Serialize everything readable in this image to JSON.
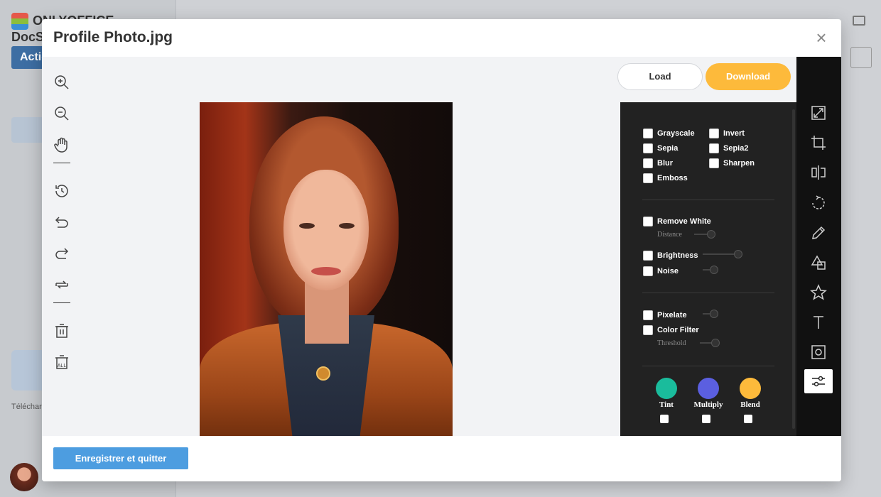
{
  "background": {
    "logo_text": "ONLYOFFICE DocSpace",
    "action_label": "Actions",
    "download_caption": "Télécharger"
  },
  "modal": {
    "title": "Profile Photo.jpg",
    "close_glyph": "×"
  },
  "left_toolbar": {
    "tools": [
      {
        "name": "zoom-in-icon"
      },
      {
        "name": "zoom-out-icon"
      },
      {
        "name": "hand-icon"
      },
      {
        "name": "history-icon"
      },
      {
        "name": "undo-icon"
      },
      {
        "name": "redo-icon"
      },
      {
        "name": "reset-icon"
      },
      {
        "name": "delete-icon"
      },
      {
        "name": "delete-all-icon",
        "label": "ALL"
      }
    ]
  },
  "actions": {
    "load_label": "Load",
    "download_label": "Download"
  },
  "filters": {
    "basic": [
      "Grayscale",
      "Invert",
      "Sepia",
      "Sepia2",
      "Blur",
      "Sharpen",
      "Emboss"
    ],
    "remove_white": "Remove White",
    "distance": "Distance",
    "brightness": "Brightness",
    "noise": "Noise",
    "pixelate": "Pixelate",
    "color_filter": "Color Filter",
    "threshold": "Threshold",
    "swatches": [
      {
        "label": "Tint",
        "color": "#1abc9c"
      },
      {
        "label": "Multiply",
        "color": "#5b5fe0"
      },
      {
        "label": "Blend",
        "color": "#fdba3b"
      }
    ]
  },
  "right_toolbar": {
    "tools": [
      "resize-icon",
      "crop-icon",
      "flip-icon",
      "rotate-icon",
      "draw-icon",
      "shape-icon",
      "icon-star-icon",
      "text-icon",
      "mask-icon",
      "filter-icon"
    ],
    "active": "filter-icon"
  },
  "footer": {
    "save_label": "Enregistrer et quitter"
  },
  "colors": {
    "accent_orange": "#fdba3b",
    "save_blue": "#4d9de0",
    "panel_dark": "#222222"
  }
}
